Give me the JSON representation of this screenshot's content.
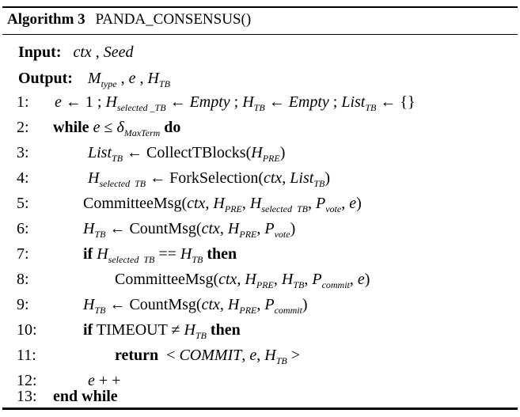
{
  "caption": {
    "label": "Algorithm 3",
    "name": "PANDA_CONSENSUS()"
  },
  "input": {
    "label": "Input:",
    "text": "ctx , Seed"
  },
  "output": {
    "label": "Output:",
    "text": "M_type , e , H_TB"
  },
  "lines": [
    {
      "num": "1:",
      "text": "e ← 1 ; H_selected_TB ← Empty ; H_TB ← Empty ; List_TB ← {}"
    },
    {
      "num": "2:",
      "text": "while e ≤ δ_MaxTerm do"
    },
    {
      "num": "3:",
      "text": "List_TB ← CollectTBlocks(H_PRE)"
    },
    {
      "num": "4:",
      "text": "H_selected TB ← ForkSelection(ctx, List_TB)"
    },
    {
      "num": "5:",
      "text": "CommitteeMsg(ctx, H_PRE, H_selected TB, P_vote, e)"
    },
    {
      "num": "6:",
      "text": "H_TB ← CountMsg(ctx, H_PRE, P_vote)"
    },
    {
      "num": "7:",
      "text": "if H_selected TB == H_TB then"
    },
    {
      "num": "8:",
      "text": "CommitteeMsg(ctx, H_PRE, H_TB, P_commit, e)"
    },
    {
      "num": "9:",
      "text": "H_TB ← CountMsg(ctx, H_PRE, P_commit)"
    },
    {
      "num": "10:",
      "text": "if TIMEOUT ≠ H_TB then"
    },
    {
      "num": "11:",
      "text": "return < COMMIT, e, H_TB >"
    },
    {
      "num": "12:",
      "text": "e + +"
    },
    {
      "num": "13:",
      "text": "end while"
    }
  ]
}
